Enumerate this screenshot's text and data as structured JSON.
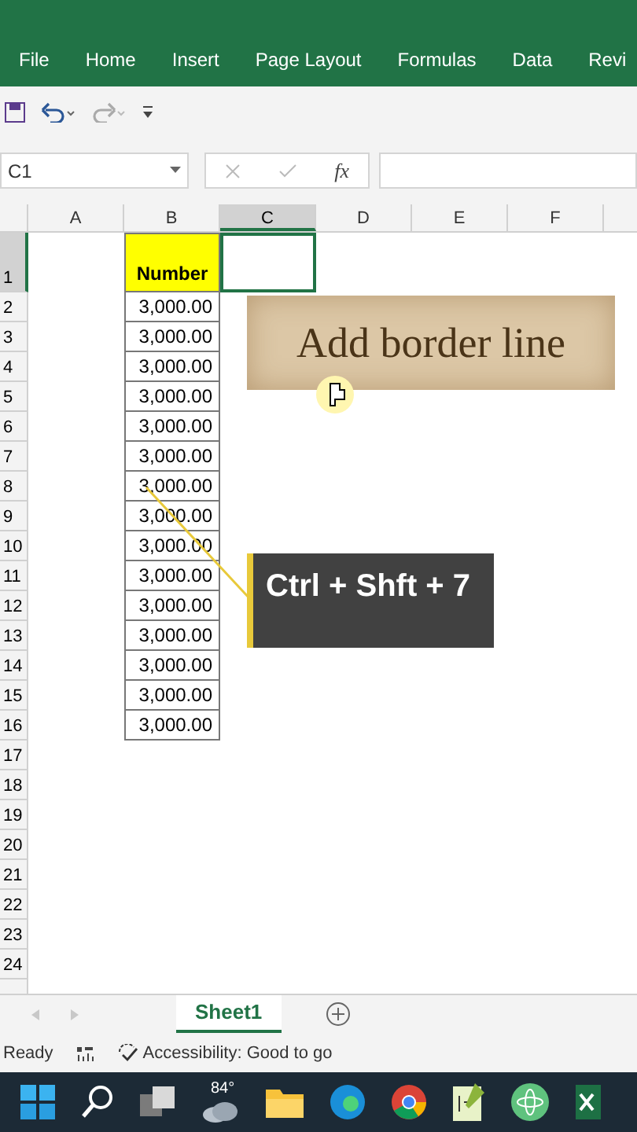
{
  "ribbon_tabs": [
    {
      "label": "File"
    },
    {
      "label": "Home"
    },
    {
      "label": "Insert"
    },
    {
      "label": "Page Layout"
    },
    {
      "label": "Formulas"
    },
    {
      "label": "Data"
    },
    {
      "label": "Revi"
    }
  ],
  "name_box": {
    "value": "C1"
  },
  "formula_bar": {
    "fx": "fx"
  },
  "sheet": {
    "columns": [
      {
        "label": "A",
        "selected": false
      },
      {
        "label": "B",
        "selected": false
      },
      {
        "label": "C",
        "selected": true
      },
      {
        "label": "D",
        "selected": false
      },
      {
        "label": "E",
        "selected": false
      },
      {
        "label": "F",
        "selected": false
      }
    ],
    "rows": [
      {
        "label": "1",
        "selected": true,
        "b": "Number",
        "kind": "header"
      },
      {
        "label": "2",
        "selected": false,
        "b": "3,000.00",
        "kind": "value"
      },
      {
        "label": "3",
        "selected": false,
        "b": "3,000.00",
        "kind": "value"
      },
      {
        "label": "4",
        "selected": false,
        "b": "3,000.00",
        "kind": "value"
      },
      {
        "label": "5",
        "selected": false,
        "b": "3,000.00",
        "kind": "value"
      },
      {
        "label": "6",
        "selected": false,
        "b": "3,000.00",
        "kind": "value"
      },
      {
        "label": "7",
        "selected": false,
        "b": "3,000.00",
        "kind": "value"
      },
      {
        "label": "8",
        "selected": false,
        "b": "3,000.00",
        "kind": "value"
      },
      {
        "label": "9",
        "selected": false,
        "b": "3,000.00",
        "kind": "value"
      },
      {
        "label": "10",
        "selected": false,
        "b": "3,000.00",
        "kind": "value"
      },
      {
        "label": "11",
        "selected": false,
        "b": "3,000.00",
        "kind": "value"
      },
      {
        "label": "12",
        "selected": false,
        "b": "3,000.00",
        "kind": "value"
      },
      {
        "label": "13",
        "selected": false,
        "b": "3,000.00",
        "kind": "value"
      },
      {
        "label": "14",
        "selected": false,
        "b": "3,000.00",
        "kind": "value"
      },
      {
        "label": "15",
        "selected": false,
        "b": "3,000.00",
        "kind": "value"
      },
      {
        "label": "16",
        "selected": false,
        "b": "3,000.00",
        "kind": "value"
      },
      {
        "label": "17",
        "selected": false,
        "kind": "empty"
      },
      {
        "label": "18",
        "selected": false,
        "kind": "empty"
      },
      {
        "label": "19",
        "selected": false,
        "kind": "empty"
      },
      {
        "label": "20",
        "selected": false,
        "kind": "empty"
      },
      {
        "label": "21",
        "selected": false,
        "kind": "empty"
      },
      {
        "label": "22",
        "selected": false,
        "kind": "empty"
      },
      {
        "label": "23",
        "selected": false,
        "kind": "empty"
      },
      {
        "label": "24",
        "selected": false,
        "kind": "empty"
      }
    ]
  },
  "callouts": [
    {
      "kind": "paper",
      "text": "Add border line"
    },
    {
      "kind": "shortcut",
      "text": "Ctrl + Shft + 7"
    }
  ],
  "sheet_tabs": [
    {
      "label": "Sheet1",
      "selected": true
    }
  ],
  "status_bar": {
    "mode": "Ready",
    "accessibility": "Accessibility: Good to go"
  },
  "taskbar": {
    "weather_temp": "84°"
  }
}
